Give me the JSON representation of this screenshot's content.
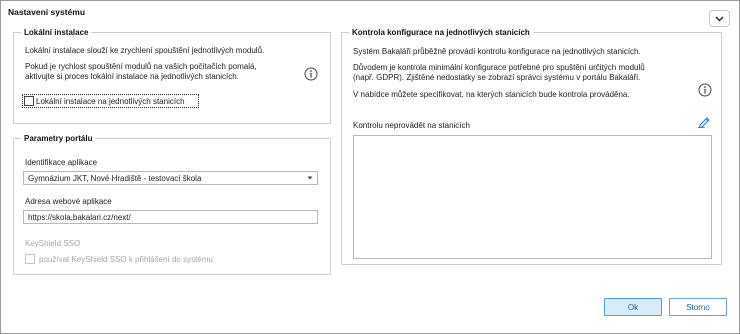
{
  "dialog": {
    "title": "Nastavení systému"
  },
  "local_install": {
    "legend": "Lokální instalace",
    "desc1": "Lokální instalace slouží ke zrychlení spouštění jednotlivých modulů.",
    "desc2_line1": "Pokud je rychlost spouštění modulů na vašich počítačích pomalá,",
    "desc2_line2": "aktivujte si proces lokální instalace na jednotlivých stanicích.",
    "checkbox_label": "Lokální instalace na jednotlivých stanicích",
    "checkbox_checked": false
  },
  "portal": {
    "legend": "Parametry portálu",
    "app_id_label": "Identifikace aplikace",
    "app_id_value": "Gymnázium JKT, Nové Hradiště - testovací škola",
    "web_address_label": "Adresa webové aplikace",
    "web_address_value": "https://skola.bakalari.cz/next/",
    "keyshield_label": "KeyShield SSO",
    "keyshield_checkbox_label": "používat KeyShield SSO k přihlášení do systému",
    "keyshield_checked": false
  },
  "config_check": {
    "legend": "Kontrola konfigurace na jednotlivých stanicích",
    "desc1": "Systém Bakaláři průběžně provádí kontrolu konfigurace na jednotlivých stanicích.",
    "desc2_line1": "Důvodem je kontrola minimální konfigurace potřebné pro spuštění určitých modulů",
    "desc2_line2": "(např. GDPR). Zjištěné nedostatky se zobrazí správci systému v portálu Bakaláři.",
    "desc3": "V nabídce můžete specifikovat, na kterých stanicích bude kontrola prováděna.",
    "exclude_label": "Kontrolu neprovádět na stanicích",
    "exclude_value": ""
  },
  "buttons": {
    "ok": "Ok",
    "cancel": "Storno"
  },
  "colors": {
    "accent": "#4f9fd0",
    "primary_fill": "#d7ecf7",
    "border": "#cfcfcf"
  },
  "icons": [
    "chevron-down-icon",
    "info-icon",
    "edit-pencil-icon",
    "dropdown-arrow-icon"
  ]
}
